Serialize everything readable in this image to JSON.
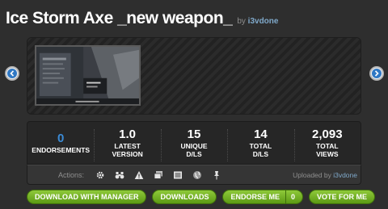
{
  "header": {
    "title": "Ice Storm Axe _new weapon_",
    "by_label": "by",
    "author": "i3vdone"
  },
  "gallery": {
    "prev_icon": "chevron-left-icon",
    "next_icon": "chevron-right-icon"
  },
  "stats": [
    {
      "value": "0",
      "label": "ENDORSEMENTS"
    },
    {
      "value": "1.0",
      "label": "LATEST VERSION"
    },
    {
      "value": "15",
      "label": "UNIQUE D/LS"
    },
    {
      "value": "14",
      "label": "TOTAL D/LS"
    },
    {
      "value": "2,093",
      "label": "TOTAL VIEWS"
    }
  ],
  "actions": {
    "label": "Actions:",
    "icons": [
      "gear-icon",
      "binoculars-icon",
      "warning-icon",
      "images-icon",
      "list-icon",
      "globe-icon",
      "pin-icon"
    ],
    "uploaded_label": "Uploaded by",
    "uploader": "i3vdone"
  },
  "buttons": {
    "download_manager": "DOWNLOAD WITH MANAGER",
    "downloads": "DOWNLOADS",
    "endorse": "ENDORSE ME",
    "endorse_count": "0",
    "vote": "VOTE FOR ME"
  },
  "colors": {
    "accent_blue": "#3b8bd6",
    "button_green": "#7ab72a",
    "background": "#2e2e2e"
  }
}
